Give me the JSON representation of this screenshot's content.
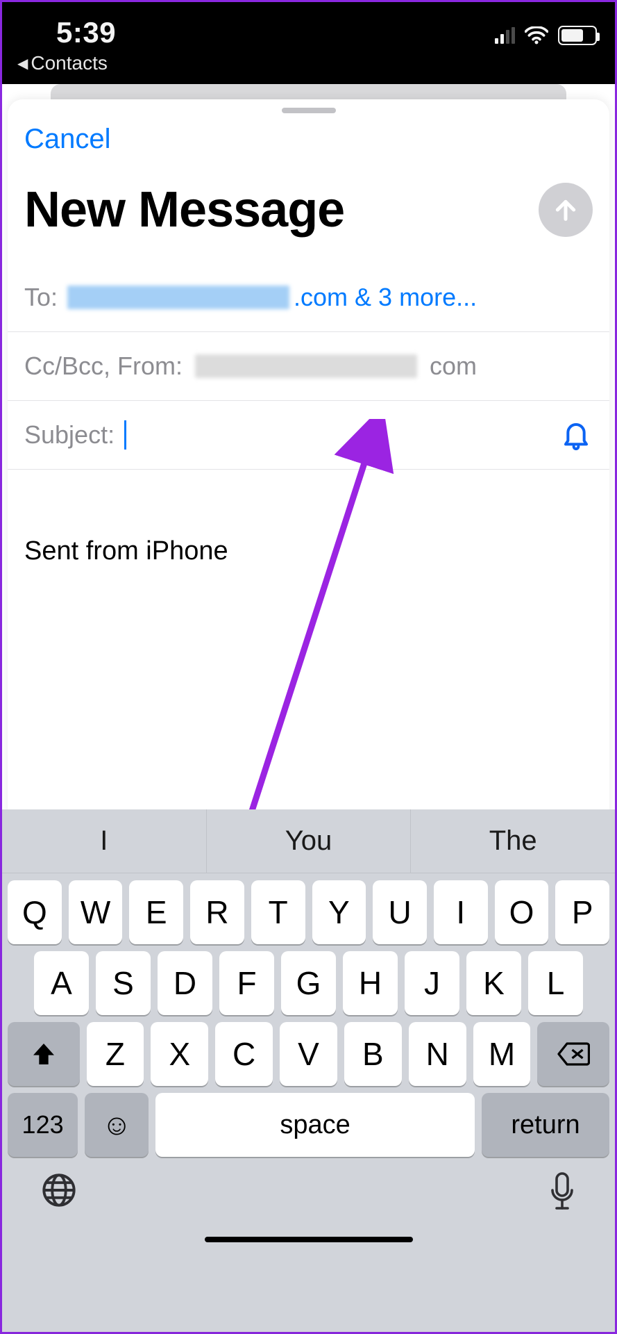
{
  "statusbar": {
    "time": "5:39",
    "back_app_label": "Contacts"
  },
  "sheet": {
    "cancel": "Cancel",
    "title": "New Message",
    "fields": {
      "to_label": "To:",
      "to_visible_suffix": ".com & 3 more...",
      "ccbcc_from_label": "Cc/Bcc, From:",
      "from_visible_suffix": "com",
      "subject_label": "Subject:",
      "subject_value": ""
    },
    "body_signature": "Sent from iPhone"
  },
  "keyboard": {
    "suggestions": [
      "I",
      "You",
      "The"
    ],
    "row1": [
      "Q",
      "W",
      "E",
      "R",
      "T",
      "Y",
      "U",
      "I",
      "O",
      "P"
    ],
    "row2": [
      "A",
      "S",
      "D",
      "F",
      "G",
      "H",
      "J",
      "K",
      "L"
    ],
    "row3": [
      "Z",
      "X",
      "C",
      "V",
      "B",
      "N",
      "M"
    ],
    "mode_key": "123",
    "space_label": "space",
    "return_label": "return"
  }
}
